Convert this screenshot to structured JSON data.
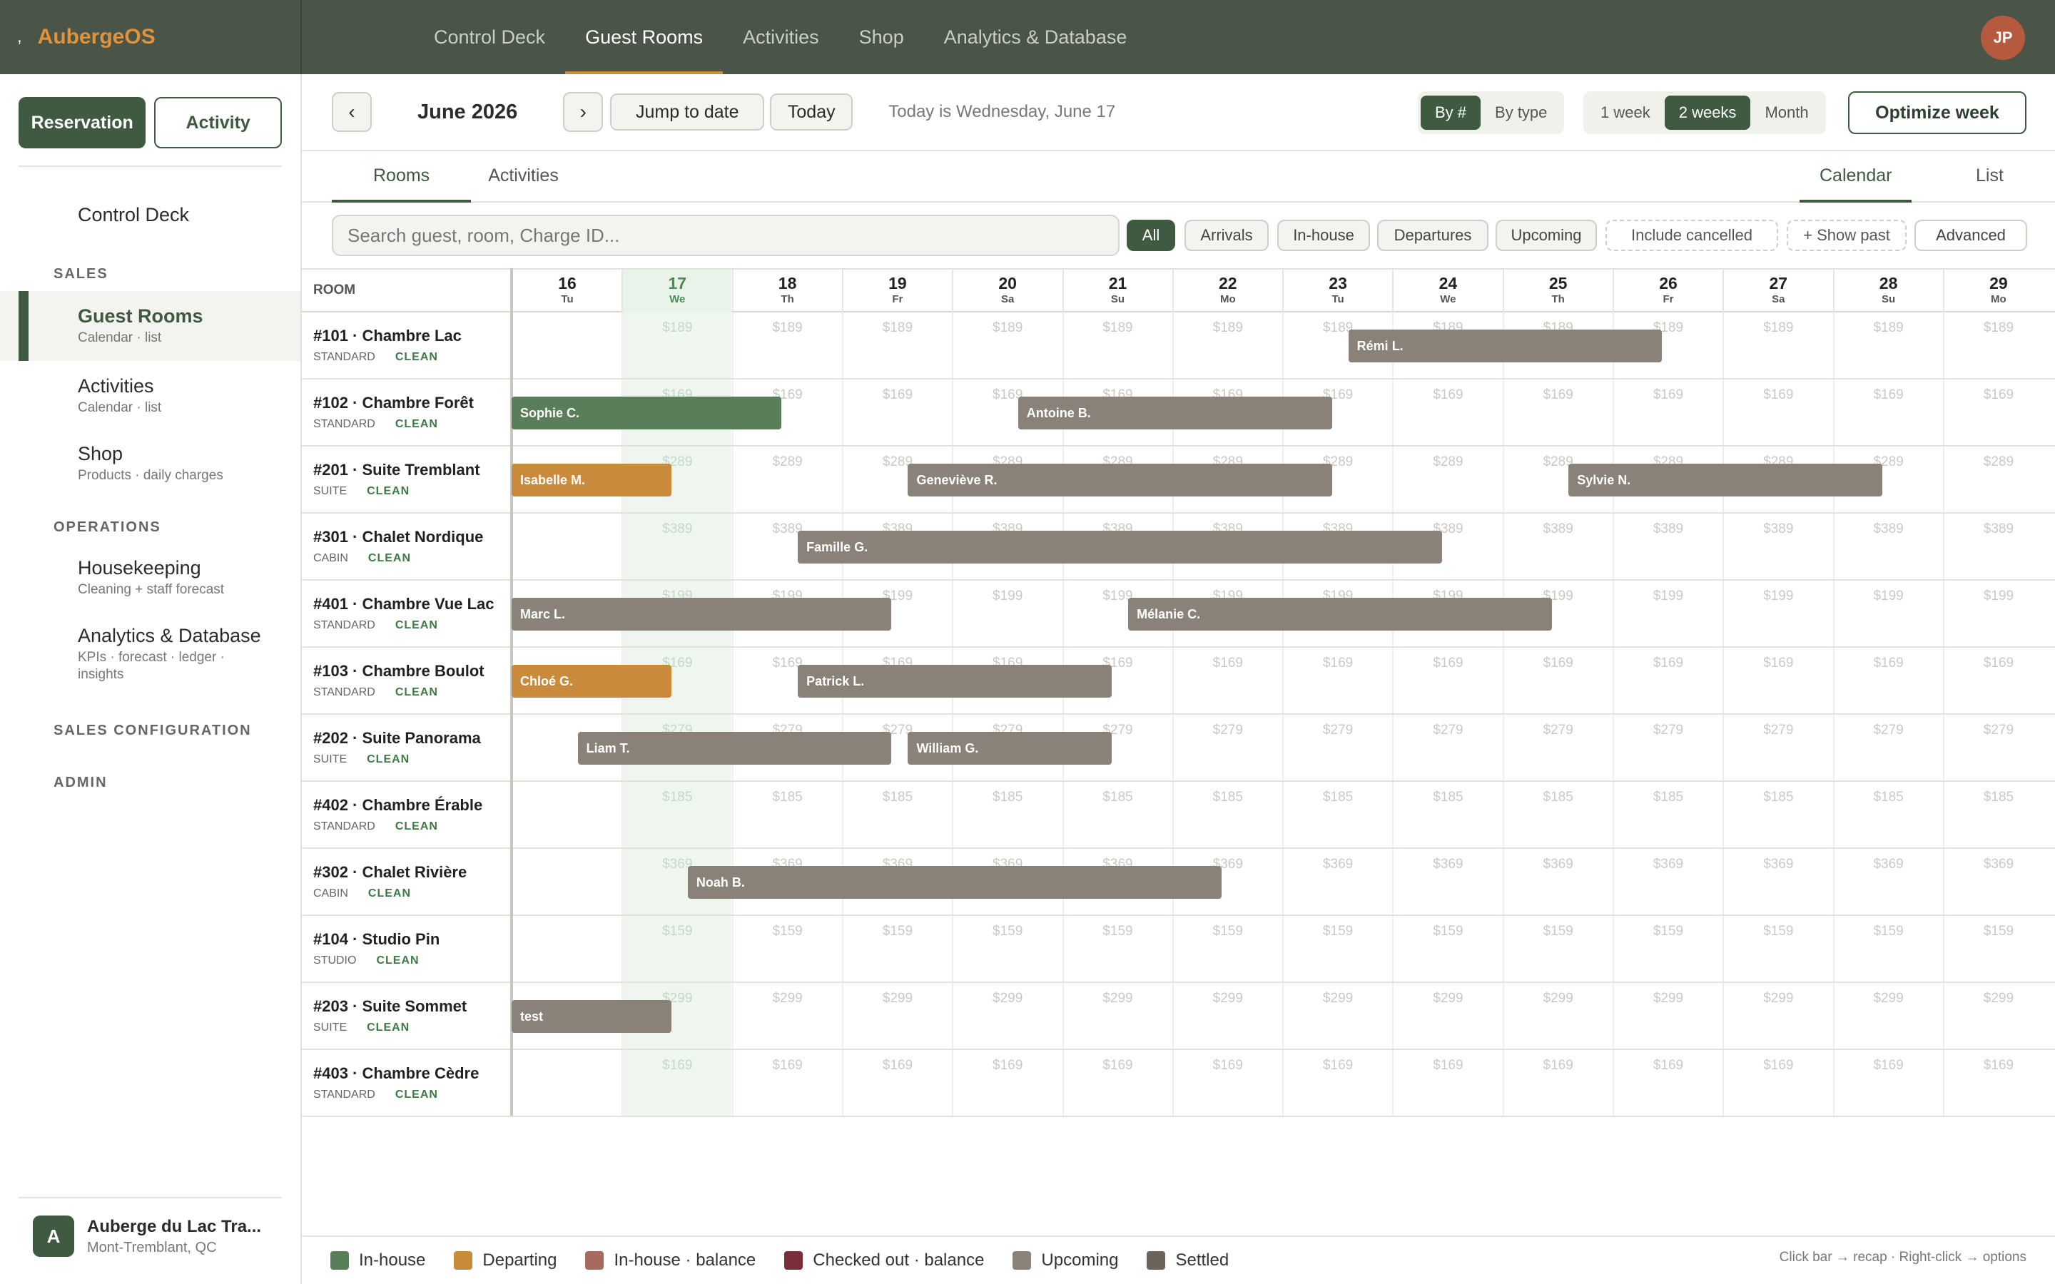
{
  "brand": {
    "mark": ",",
    "name": "AubergeOS"
  },
  "topnav": [
    {
      "label": "Control Deck"
    },
    {
      "label": "Guest Rooms"
    },
    {
      "label": "Activities"
    },
    {
      "label": "Shop"
    },
    {
      "label": "Analytics & Database"
    }
  ],
  "user": {
    "initials": "JP"
  },
  "sidebar": {
    "reservation_btn": "Reservation",
    "activity_btn": "Activity",
    "control_deck": "Control Deck",
    "sales_header": "SALES",
    "items": [
      {
        "title": "Guest Rooms",
        "sub": "Calendar · list"
      },
      {
        "title": "Activities",
        "sub": "Calendar · list"
      },
      {
        "title": "Shop",
        "sub": "Products · daily charges"
      }
    ],
    "operations_header": "OPERATIONS",
    "ops_items": [
      {
        "title": "Housekeeping",
        "sub": "Cleaning + staff forecast"
      },
      {
        "title": "Analytics & Database",
        "sub": "KPIs · forecast · ledger ·",
        "sub2": "insights"
      }
    ],
    "sales_config_header": "SALES CONFIGURATION",
    "admin_header": "ADMIN",
    "footer": {
      "initial": "A",
      "name": "Auberge du Lac Tra...",
      "location": "Mont-Tremblant, QC"
    }
  },
  "toolbar": {
    "prev": "‹",
    "month": "June 2026",
    "next": "›",
    "jump": "Jump to date",
    "today_btn": "Today",
    "today_text": "Today is Wednesday, June 17",
    "by_num": "By #",
    "by_type": "By type",
    "week1": "1 week",
    "week2": "2 weeks",
    "month_opt": "Month",
    "optimize": "Optimize week"
  },
  "tabs": {
    "rooms": "Rooms",
    "activities": "Activities",
    "calendar": "Calendar",
    "list": "List"
  },
  "filters": {
    "search_placeholder": "Search guest, room, Charge ID...",
    "all": "All",
    "arrivals": "Arrivals",
    "inhouse": "In-house",
    "departures": "Departures",
    "upcoming": "Upcoming",
    "include_cancelled": "Include cancelled",
    "show_past": "+ Show past",
    "advanced": "Advanced"
  },
  "calendar": {
    "room_header": "ROOM",
    "days": [
      {
        "n": "16",
        "w": "Tu"
      },
      {
        "n": "17",
        "w": "We"
      },
      {
        "n": "18",
        "w": "Th"
      },
      {
        "n": "19",
        "w": "Fr"
      },
      {
        "n": "20",
        "w": "Sa"
      },
      {
        "n": "21",
        "w": "Su"
      },
      {
        "n": "22",
        "w": "Mo"
      },
      {
        "n": "23",
        "w": "Tu"
      },
      {
        "n": "24",
        "w": "We"
      },
      {
        "n": "25",
        "w": "Th"
      },
      {
        "n": "26",
        "w": "Fr"
      },
      {
        "n": "27",
        "w": "Sa"
      },
      {
        "n": "28",
        "w": "Su"
      },
      {
        "n": "29",
        "w": "Mo"
      }
    ],
    "rooms": [
      {
        "name": "#101 · Chambre Lac",
        "type": "STANDARD",
        "status": "CLEAN",
        "rate": "$189"
      },
      {
        "name": "#102 · Chambre Forêt",
        "type": "STANDARD",
        "status": "CLEAN",
        "rate": "$169"
      },
      {
        "name": "#201 · Suite Tremblant",
        "type": "SUITE",
        "status": "CLEAN",
        "rate": "$289"
      },
      {
        "name": "#301 · Chalet Nordique",
        "type": "CABIN",
        "status": "CLEAN",
        "rate": "$389"
      },
      {
        "name": "#401 · Chambre Vue Lac",
        "type": "STANDARD",
        "status": "CLEAN",
        "rate": "$199"
      },
      {
        "name": "#103 · Chambre Boulot",
        "type": "STANDARD",
        "status": "CLEAN",
        "rate": "$169"
      },
      {
        "name": "#202 · Suite Panorama",
        "type": "SUITE",
        "status": "CLEAN",
        "rate": "$279"
      },
      {
        "name": "#402 · Chambre Érable",
        "type": "STANDARD",
        "status": "CLEAN",
        "rate": "$185"
      },
      {
        "name": "#302 · Chalet Rivière",
        "type": "CABIN",
        "status": "CLEAN",
        "rate": "$369"
      },
      {
        "name": "#104 · Studio Pin",
        "type": "STUDIO",
        "status": "CLEAN",
        "rate": "$159"
      },
      {
        "name": "#203 · Suite Sommet",
        "type": "SUITE",
        "status": "CLEAN",
        "rate": "$299"
      },
      {
        "name": "#403 · Chambre Cèdre",
        "type": "STANDARD",
        "status": "CLEAN",
        "rate": "$169"
      }
    ],
    "bookings": [
      {
        "row": 0,
        "guest": "Rémi L.",
        "start": 7.6,
        "end": 10.45,
        "status": "up"
      },
      {
        "row": 1,
        "guest": "Sophie C.",
        "start": 0,
        "end": 2.45,
        "status": "in"
      },
      {
        "row": 1,
        "guest": "Antoine B.",
        "start": 4.6,
        "end": 7.45,
        "status": "up"
      },
      {
        "row": 2,
        "guest": "Isabelle M.",
        "start": 0,
        "end": 1.45,
        "status": "dep"
      },
      {
        "row": 2,
        "guest": "Geneviève R.",
        "start": 3.6,
        "end": 7.45,
        "status": "up"
      },
      {
        "row": 2,
        "guest": "Sylvie N.",
        "start": 9.6,
        "end": 12.45,
        "status": "up"
      },
      {
        "row": 3,
        "guest": "Famille G.",
        "start": 2.6,
        "end": 8.45,
        "status": "up"
      },
      {
        "row": 4,
        "guest": "Marc L.",
        "start": 0,
        "end": 3.45,
        "status": "up"
      },
      {
        "row": 4,
        "guest": "Mélanie C.",
        "start": 5.6,
        "end": 9.45,
        "status": "up"
      },
      {
        "row": 5,
        "guest": "Chloé G.",
        "start": 0,
        "end": 1.45,
        "status": "dep"
      },
      {
        "row": 5,
        "guest": "Patrick L.",
        "start": 2.6,
        "end": 5.45,
        "status": "up"
      },
      {
        "row": 6,
        "guest": "Liam T.",
        "start": 0.6,
        "end": 3.45,
        "status": "up"
      },
      {
        "row": 6,
        "guest": "William G.",
        "start": 3.6,
        "end": 5.45,
        "status": "up"
      },
      {
        "row": 8,
        "guest": "Noah B.",
        "start": 1.6,
        "end": 6.45,
        "status": "up"
      },
      {
        "row": 10,
        "guest": "test",
        "start": 0,
        "end": 1.45,
        "status": "up"
      }
    ]
  },
  "legend": [
    {
      "label": "In-house",
      "color": "#5a7e5a"
    },
    {
      "label": "Departing",
      "color": "#c98a3c"
    },
    {
      "label": "In-house · balance",
      "color": "#a86a5e"
    },
    {
      "label": "Checked out · balance",
      "color": "#7a2e3a"
    },
    {
      "label": "Upcoming",
      "color": "#8a8279"
    },
    {
      "label": "Settled",
      "color": "#6b6359"
    }
  ],
  "hint": "Click bar → recap · Right-click → options"
}
